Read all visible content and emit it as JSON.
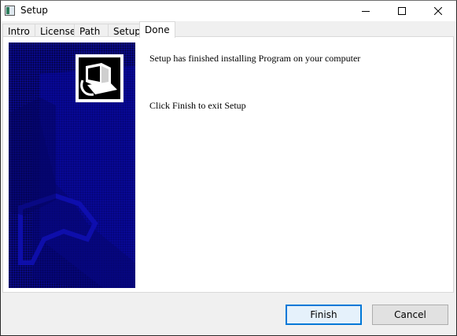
{
  "window": {
    "title": "Setup",
    "colors": {
      "banner": "#08088a",
      "accent": "#0078d7"
    }
  },
  "titlebar_icons": [
    "app-icon",
    "minimize-icon",
    "maximize-icon",
    "close-icon"
  ],
  "tabs": [
    {
      "label": "Intro",
      "active": false
    },
    {
      "label": "License",
      "active": false
    },
    {
      "label": "Path",
      "active": false
    },
    {
      "label": "Setup",
      "active": false
    },
    {
      "label": "Done",
      "active": true
    }
  ],
  "content": {
    "banner_icon": "installer-computer-icon",
    "line1": "Setup has finished installing Program on your computer",
    "line2": "Click Finish to exit Setup"
  },
  "buttons": {
    "finish": "Finish",
    "cancel": "Cancel"
  }
}
